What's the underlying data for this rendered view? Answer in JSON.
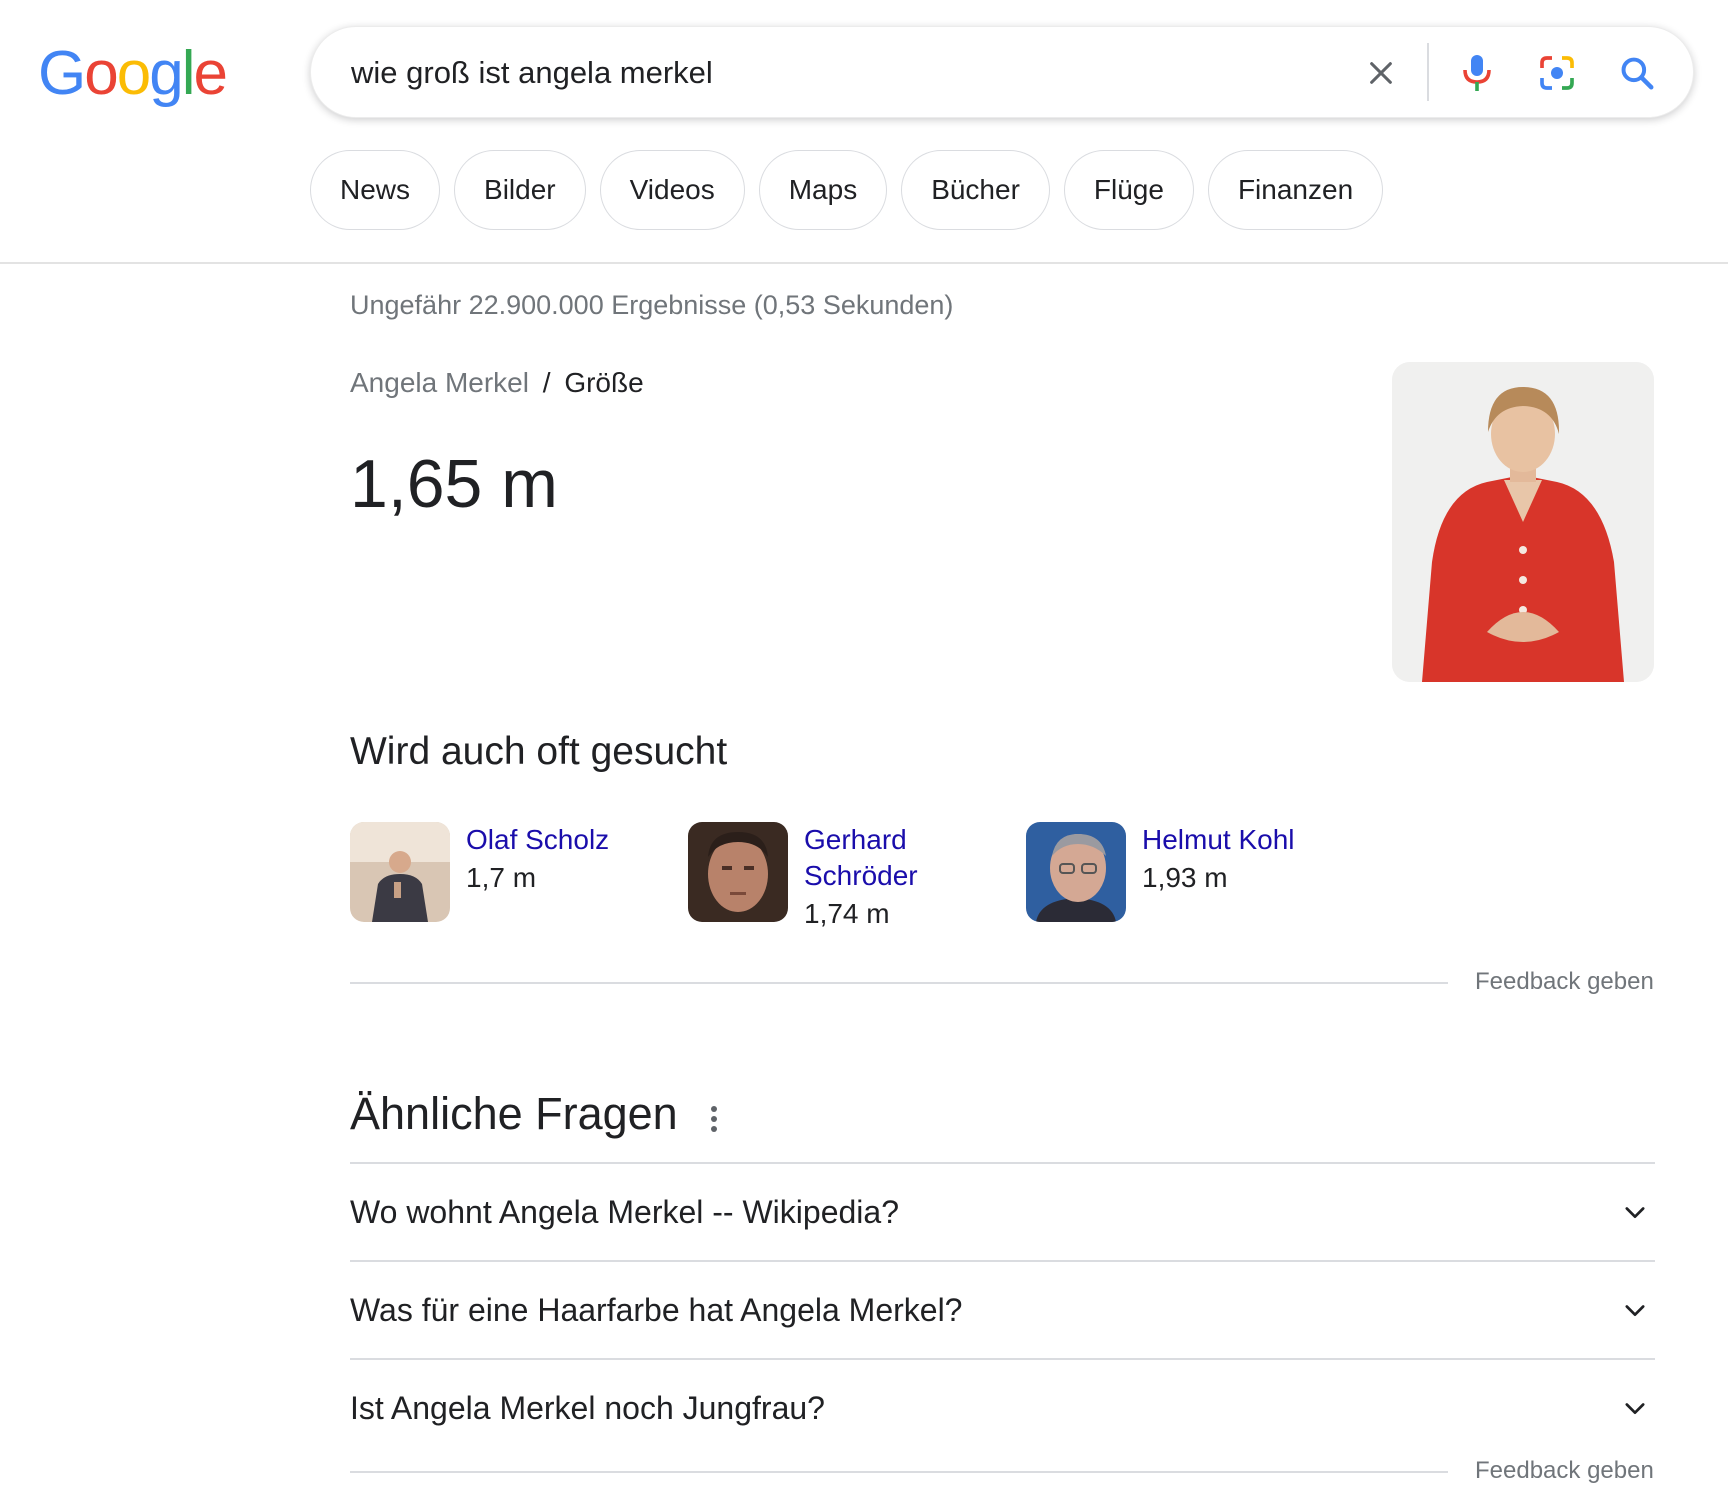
{
  "logo": {
    "text": "Google",
    "letters": [
      {
        "ch": "G",
        "color": "#4285F4"
      },
      {
        "ch": "o",
        "color": "#EA4335"
      },
      {
        "ch": "o",
        "color": "#FBBC05"
      },
      {
        "ch": "g",
        "color": "#4285F4"
      },
      {
        "ch": "l",
        "color": "#34A853"
      },
      {
        "ch": "e",
        "color": "#EA4335"
      }
    ]
  },
  "search": {
    "query": "wie groß ist angela merkel",
    "icons": [
      "close-icon",
      "microphone-icon",
      "camera-lens-icon",
      "search-icon"
    ]
  },
  "chips": [
    "News",
    "Bilder",
    "Videos",
    "Maps",
    "Bücher",
    "Flüge",
    "Finanzen"
  ],
  "result_stats": "Ungefähr 22.900.000 Ergebnisse (0,53 Sekunden)",
  "answer": {
    "breadcrumb_entity": "Angela Merkel",
    "breadcrumb_separator": "/",
    "breadcrumb_attribute": "Größe",
    "value": "1,65 m"
  },
  "also_searched": {
    "title": "Wird auch oft gesucht",
    "people": [
      {
        "name": "Olaf Scholz",
        "height": "1,7 m"
      },
      {
        "name": "Gerhard Schröder",
        "height": "1,74 m"
      },
      {
        "name": "Helmut Kohl",
        "height": "1,93 m"
      }
    ],
    "feedback": "Feedback geben"
  },
  "related_questions": {
    "title": "Ähnliche Fragen",
    "questions": [
      "Wo wohnt Angela Merkel -- Wikipedia?",
      "Was für eine Haarfarbe hat Angela Merkel?",
      "Ist Angela Merkel noch Jungfrau?"
    ],
    "feedback": "Feedback geben"
  },
  "colors": {
    "link": "#1a0dab",
    "secondary_text": "#70757a",
    "divider": "#dadce0"
  }
}
